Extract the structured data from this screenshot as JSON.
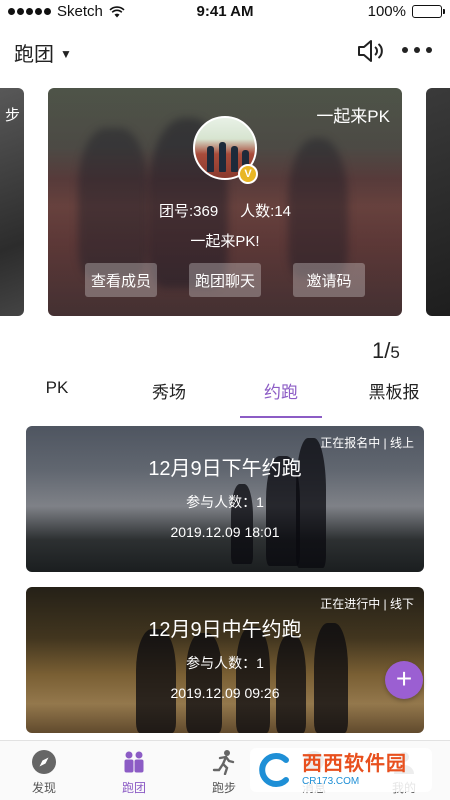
{
  "status_bar": {
    "carrier": "Sketch",
    "time": "9:41 AM",
    "battery": "100%"
  },
  "header": {
    "title": "跑团",
    "icons": [
      "chevron-down-icon",
      "speaker-icon",
      "more-icon"
    ]
  },
  "carousel": {
    "left_card_label": "步",
    "main_card": {
      "badge_text": "一起来PK",
      "group_number": "团号:369",
      "member_count": "人数:14",
      "slogan": "一起来PK!",
      "verified_badge": "V",
      "buttons": [
        "查看成员",
        "跑团聊天",
        "邀请码"
      ]
    },
    "page_current": "1",
    "page_separator": "/",
    "page_total": "5"
  },
  "tabs": {
    "items": [
      "PK",
      "秀场",
      "约跑",
      "黑板报"
    ],
    "active": "约跑"
  },
  "events": [
    {
      "status": "正在报名中 | 线上",
      "title": "12月9日下午约跑",
      "participants": "参与人数：1",
      "time": "2019.12.09 18:01"
    },
    {
      "status": "正在进行中 | 线下",
      "title": "12月9日中午约跑",
      "participants": "参与人数：1",
      "time": "2019.12.09 09:26"
    }
  ],
  "fab": {
    "label": "+"
  },
  "bottom_nav": {
    "items": [
      "发现",
      "跑团",
      "跑步",
      "消息",
      "我的"
    ],
    "active": "跑团"
  },
  "watermark": {
    "text": "西西软件园",
    "subtext": "CR173.COM"
  },
  "colors": {
    "accent": "#8c5cc5",
    "fab": "#9b5fd2",
    "badge": "#e8b625"
  }
}
